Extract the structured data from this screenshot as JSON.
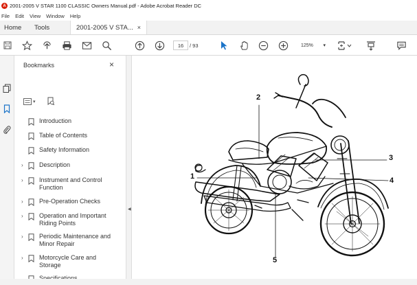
{
  "window": {
    "title": "2001-2005 V STAR 1100 CLASSIC Owners Manual.pdf - Adobe Acrobat Reader DC"
  },
  "menubar": {
    "items": [
      "File",
      "Edit",
      "View",
      "Window",
      "Help"
    ]
  },
  "tabs": {
    "home": "Home",
    "tools": "Tools",
    "document": "2001-2005 V STA...",
    "close_glyph": "×"
  },
  "toolbar": {
    "page_current": "16",
    "page_total": "/ 93",
    "zoom": "125%",
    "zoom_caret": "▾"
  },
  "bookmarks": {
    "title": "Bookmarks",
    "close_glyph": "×",
    "options_caret": "▾",
    "items": [
      {
        "label": "Introduction",
        "expandable": false
      },
      {
        "label": "Table of Contents",
        "expandable": false
      },
      {
        "label": "Safety Information",
        "expandable": false
      },
      {
        "label": "Description",
        "expandable": true
      },
      {
        "label": "Instrument and Control Function",
        "expandable": true
      },
      {
        "label": "Pre-Operation Checks",
        "expandable": true
      },
      {
        "label": "Operation and Important Riding Points",
        "expandable": true
      },
      {
        "label": "Periodic Maintenance and Minor Repair",
        "expandable": true
      },
      {
        "label": "Motorcycle Care and Storage",
        "expandable": true
      },
      {
        "label": "Specifications",
        "expandable": false
      }
    ]
  },
  "document": {
    "callouts": [
      "1",
      "2",
      "3",
      "4",
      "5"
    ]
  },
  "icons": {
    "app": "acrobat-icon",
    "save": "save-icon",
    "bookmark_add": "star-icon",
    "upload": "upload-icon",
    "print": "print-icon",
    "email": "mail-icon",
    "search": "search-icon",
    "prev_page": "arrow-up-circle-icon",
    "next_page": "arrow-down-circle-icon",
    "select": "cursor-icon",
    "hand": "hand-icon",
    "zoom_out": "minus-circle-icon",
    "zoom_in": "plus-circle-icon",
    "fit": "fit-page-icon",
    "scroll": "scroll-mode-icon",
    "comment": "comment-icon"
  },
  "colors": {
    "acrobat_red": "#d81e05",
    "select_blue": "#1a73c8"
  }
}
